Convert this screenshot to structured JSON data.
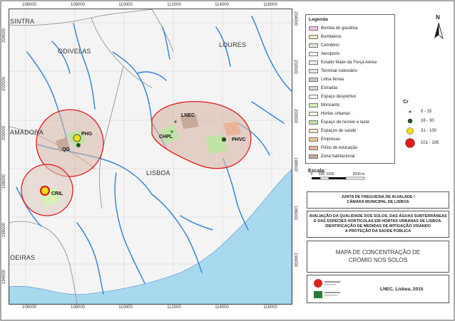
{
  "map": {
    "x_ticks": [
      "106000",
      "108000",
      "110000",
      "112000",
      "114000",
      "116000"
    ],
    "y_ticks": [
      "204000",
      "202000",
      "200000",
      "198000",
      "196000",
      "194000"
    ],
    "places": [
      "SINTRA",
      "ODIVELAS",
      "LOURES",
      "AMADORA",
      "LISBOA",
      "OEIRAS"
    ],
    "sites": [
      "PHG",
      "QG",
      "CRIL",
      "LNEC",
      "CHPL",
      "PHVC"
    ],
    "colors": {
      "river": "#3b86d6",
      "sea": "#a9d9ef",
      "buffer": "#e21b1b",
      "habitacional": "#c7a89b",
      "recreio": "#bfe3a5",
      "monsanto": "#d8f0b8"
    }
  },
  "legend": {
    "title": "Legenda",
    "items": [
      {
        "label": "Bomba de gasolina",
        "color": "#f3c1e3"
      },
      {
        "label": "Bombeiros",
        "color": "#f0e3c2"
      },
      {
        "label": "Cemitério",
        "color": "#dcebd8"
      },
      {
        "label": "Aeroporto",
        "color": "#f5f5f5"
      },
      {
        "label": "Estado Maior da Força Aérea",
        "color": "#eeeeee"
      },
      {
        "label": "Terminal rodoviário",
        "color": "#e4e4e4"
      },
      {
        "label": "Linha férrea",
        "color": "#c8c8c8"
      },
      {
        "label": "Estradas",
        "color": "#d4d4d4"
      },
      {
        "label": "Espaço desportivo",
        "color": "#f7f7f7"
      },
      {
        "label": "Monsanto",
        "color": "#d8f0b8"
      },
      {
        "label": "Hortas urbanas",
        "color": "#ecf7e2"
      },
      {
        "label": "Espaço de recreio e lazer",
        "color": "#bfe3a5"
      },
      {
        "label": "Espaços de saúde",
        "color": "#f2e5c8"
      },
      {
        "label": "Empresas",
        "color": "#e9c68e"
      },
      {
        "label": "Pólos de educação",
        "color": "#e9b49a"
      },
      {
        "label": "Zona habitacional",
        "color": "#c7a89b"
      }
    ]
  },
  "cr_legend": {
    "title": "Cr",
    "classes": [
      {
        "label": "0 - 15",
        "color": "#2e7d2e"
      },
      {
        "label": "16 - 30",
        "color": "#1f5a1f"
      },
      {
        "label": "31 - 100",
        "color": "#f2e10c"
      },
      {
        "label": "101 - 105",
        "color": "#e01b1b"
      }
    ]
  },
  "north_label": "N",
  "scale": {
    "title": "Escala:",
    "labels": [
      "0",
      "500",
      "1000",
      "2000 m"
    ]
  },
  "info": {
    "org": [
      "JUNTA DE FREGUESIA DE ALVALADE /",
      "CÂMARA MUNICIPAL DE LISBOA"
    ],
    "project": [
      "AVALIAÇÃO DA QUALIDADE DOS SOLOS, DAS ÁGUAS SUBTERRÂNEAS",
      "E DAS ESPÉCIES HORTÍCOLAS EM HORTAS URBANAS DE LISBOA.",
      "IDENTIFICAÇÃO DE MEDIDAS DE MITIGAÇÃO VISANDO",
      "A PROTEÇÃO DA SAÚDE PÚBLICA"
    ],
    "map_title": [
      "MAPA DE CONCENTRAÇÃO DE",
      "CRÓMIO NOS SOLOS"
    ],
    "credit": "LNEC, Lisboa, 2015"
  }
}
